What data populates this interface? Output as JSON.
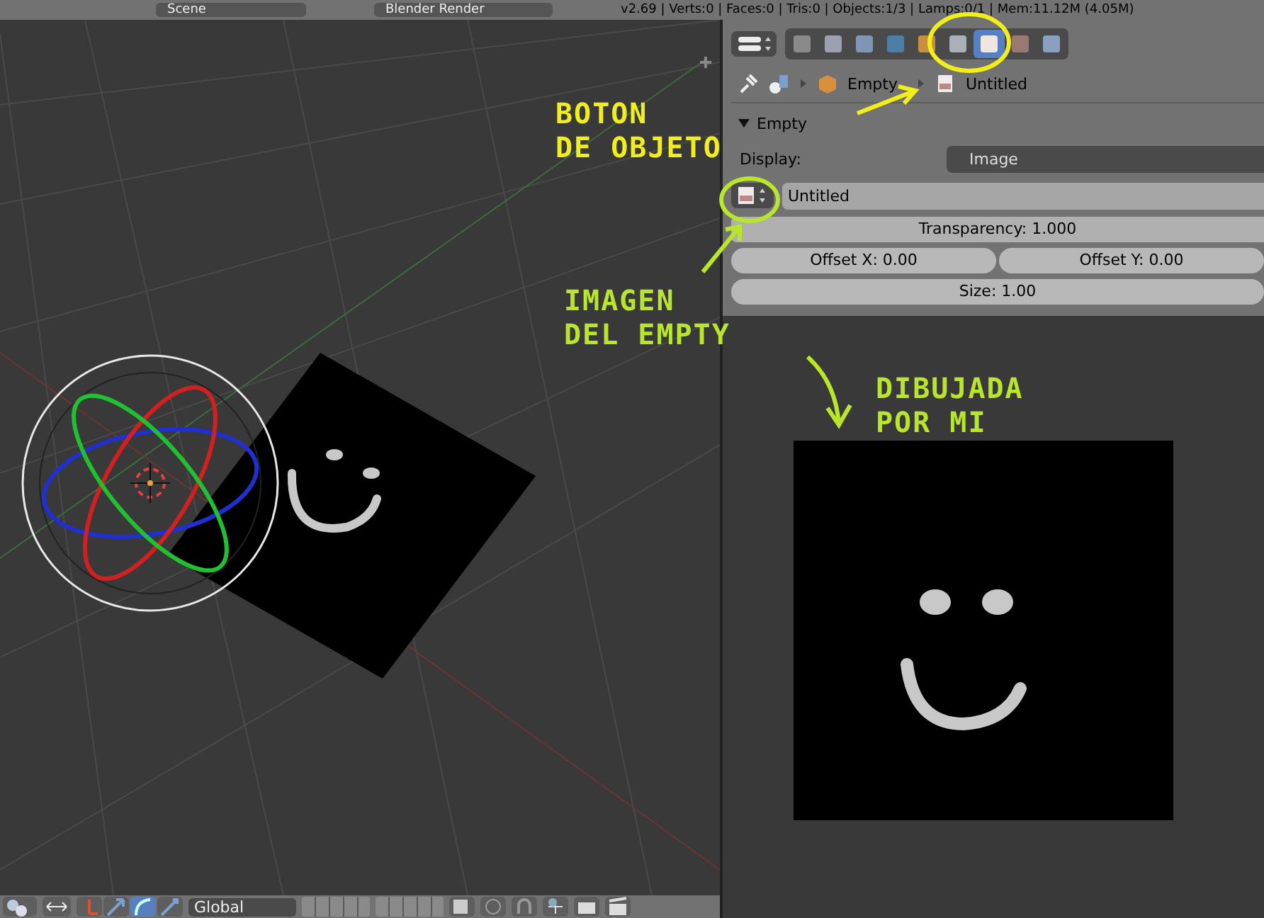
{
  "top_bar": {
    "scene": "Scene",
    "render_engine": "Blender Render",
    "stats": "v2.69 | Verts:0 | Faces:0 | Tris:0 | Objects:1/3 | Lamps:0/1 | Mem:11.12M (4.05M)"
  },
  "properties": {
    "context_tabs": [
      {
        "kind": "render",
        "selected": false
      },
      {
        "kind": "layers",
        "selected": false
      },
      {
        "kind": "scene",
        "selected": false
      },
      {
        "kind": "world",
        "selected": false
      },
      {
        "kind": "object",
        "selected": false
      },
      {
        "kind": "constraints",
        "selected": false
      },
      {
        "kind": "data",
        "selected": true
      },
      {
        "kind": "texture",
        "selected": false
      },
      {
        "kind": "physics",
        "selected": false
      }
    ],
    "breadcrumb": [
      "Empty",
      "Untitled"
    ],
    "panel": {
      "title": "Empty",
      "expanded": true,
      "display_label": "Display:",
      "display_value": "Image",
      "image": "Untitled",
      "transparency": {
        "text": "Transparency: 1.000",
        "level": 1
      },
      "offset_x": "Offset X: 0.00",
      "offset_y": "Offset Y: 0.00",
      "size": "Size: 1.00"
    }
  },
  "viewport_header": {
    "orientation": "Global"
  },
  "annotations": [
    {
      "kind": "yellow",
      "lines": [
        "BOTON",
        "DE OBJETO"
      ]
    },
    {
      "kind": "green",
      "lines": [
        "IMAGEN",
        "DEL EMPTY"
      ]
    },
    {
      "kind": "green",
      "lines": [
        "DIBUJADA",
        "POR MI"
      ]
    }
  ]
}
